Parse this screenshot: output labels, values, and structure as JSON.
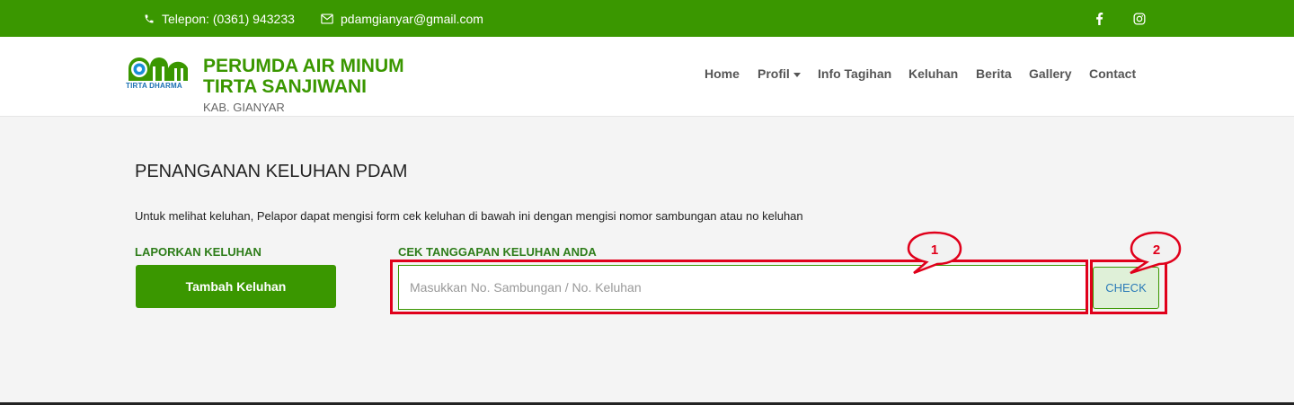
{
  "topbar": {
    "phone_text": "Telepon: (0361) 943233",
    "email_text": "pdamgianyar@gmail.com",
    "bg_color": "#3a9700"
  },
  "header": {
    "logo_caption": "TIRTA DHARMA",
    "brand_line1": "PERUMDA AIR MINUM",
    "brand_line2": "TIRTA SANJIWANI",
    "brand_sub": "KAB. GIANYAR"
  },
  "nav": {
    "items": [
      "Home",
      "Profil",
      "Info Tagihan",
      "Keluhan",
      "Berita",
      "Gallery",
      "Contact"
    ]
  },
  "main": {
    "title": "PENANGANAN KELUHAN PDAM",
    "description": "Untuk melihat keluhan, Pelapor dapat mengisi form cek keluhan di bawah ini dengan mengisi nomor sambungan atau no keluhan",
    "report_label": "LAPORKAN KELUHAN",
    "add_button": "Tambah Keluhan",
    "check_label": "CEK TANGGAPAN KELUHAN ANDA",
    "search_placeholder": "Masukkan No. Sambungan / No. Keluhan",
    "check_button": "CHECK"
  },
  "annotations": {
    "callout1": "1",
    "callout2": "2",
    "color": "#e0001b"
  }
}
